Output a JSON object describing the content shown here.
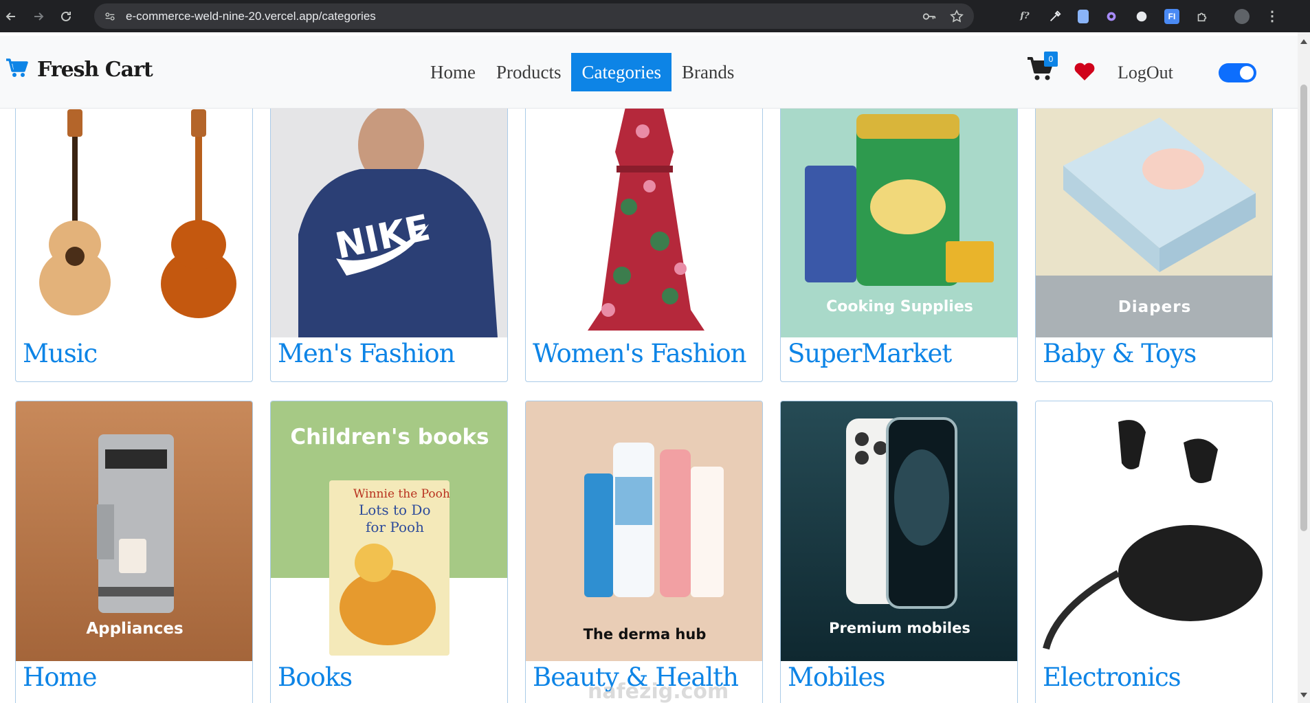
{
  "browser": {
    "url": "e-commerce-weld-nine-20.vercel.app/categories"
  },
  "site": {
    "brand": "Fresh Cart",
    "nav": [
      "Home",
      "Products",
      "Categories",
      "Brands"
    ],
    "active_nav": "Categories",
    "cart_count": "0",
    "logout": "LogOut"
  },
  "colors": {
    "accent": "#0d84e6",
    "heart": "#d0021b"
  },
  "categories": [
    {
      "name": "Music",
      "image": "guitars-image",
      "caption": ""
    },
    {
      "name": "Men's Fashion",
      "image": "nike-hoodie-image",
      "caption": ""
    },
    {
      "name": "Women's Fashion",
      "image": "floral-dress-image",
      "caption": ""
    },
    {
      "name": "SuperMarket",
      "image": "groceries-image",
      "caption": "Cooking Supplies"
    },
    {
      "name": "Baby & Toys",
      "image": "diapers-image",
      "caption": "Diapers"
    },
    {
      "name": "Home",
      "image": "coffee-machine-image",
      "caption": "Appliances"
    },
    {
      "name": "Books",
      "image": "childrens-book-image",
      "caption": "Children's books"
    },
    {
      "name": "Beauty & Health",
      "image": "skincare-image",
      "caption": "The derma hub"
    },
    {
      "name": "Mobiles",
      "image": "iphone-image",
      "caption": "Premium mobiles"
    },
    {
      "name": "Electronics",
      "image": "earbuds-image",
      "caption": ""
    }
  ],
  "book_cover_text": [
    "Winnie the Pooh",
    "Lots to Do for Pooh"
  ],
  "watermark": "nafezig.com"
}
